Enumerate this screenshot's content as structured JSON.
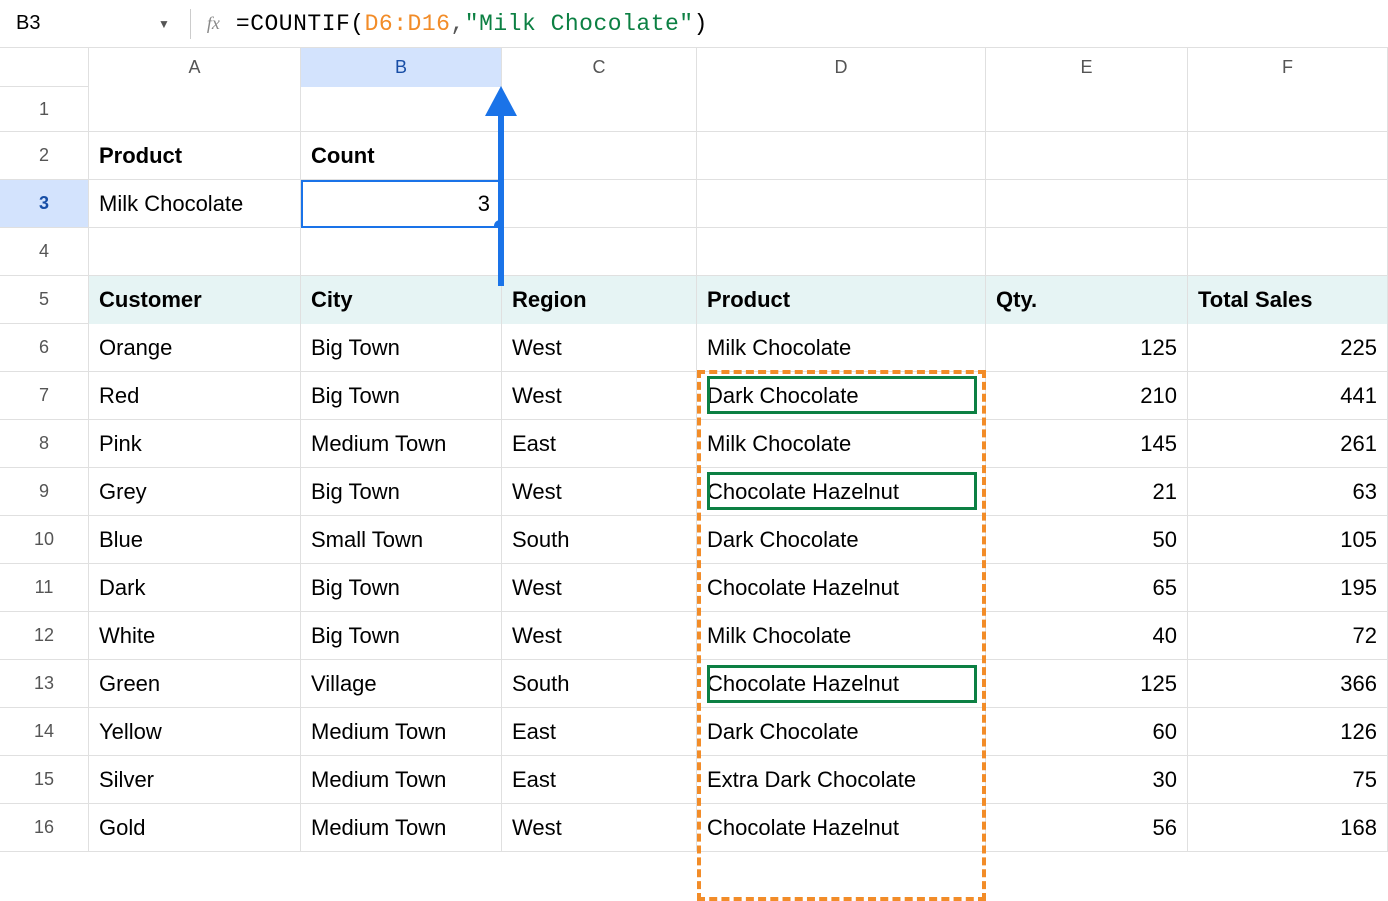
{
  "formula_bar": {
    "cell_ref": "B3",
    "formula_prefix": "=COUNTIF(",
    "formula_range": "D6:D16",
    "formula_comma": ",",
    "formula_string": "\"Milk Chocolate\"",
    "formula_suffix": ")"
  },
  "columns": [
    "A",
    "B",
    "C",
    "D",
    "E",
    "F"
  ],
  "rows": [
    "1",
    "2",
    "3",
    "4",
    "5",
    "6",
    "7",
    "8",
    "9",
    "10",
    "11",
    "12",
    "13",
    "14",
    "15",
    "16"
  ],
  "labels": {
    "product": "Product",
    "count": "Count",
    "a3": "Milk Chocolate",
    "b3": "3"
  },
  "table_headers": {
    "customer": "Customer",
    "city": "City",
    "region": "Region",
    "product": "Product",
    "qty": "Qty.",
    "total": "Total Sales"
  },
  "table": [
    {
      "customer": "Orange",
      "city": "Big Town",
      "region": "West",
      "product": "Milk Chocolate",
      "qty": "125",
      "total": "225"
    },
    {
      "customer": "Red",
      "city": "Big Town",
      "region": "West",
      "product": "Dark Chocolate",
      "qty": "210",
      "total": "441"
    },
    {
      "customer": "Pink",
      "city": "Medium Town",
      "region": "East",
      "product": "Milk Chocolate",
      "qty": "145",
      "total": "261"
    },
    {
      "customer": "Grey",
      "city": "Big Town",
      "region": "West",
      "product": "Chocolate Hazelnut",
      "qty": "21",
      "total": "63"
    },
    {
      "customer": "Blue",
      "city": "Small Town",
      "region": "South",
      "product": "Dark Chocolate",
      "qty": "50",
      "total": "105"
    },
    {
      "customer": "Dark",
      "city": "Big Town",
      "region": "West",
      "product": "Chocolate Hazelnut",
      "qty": "65",
      "total": "195"
    },
    {
      "customer": "White",
      "city": "Big Town",
      "region": "West",
      "product": "Milk Chocolate",
      "qty": "40",
      "total": "72"
    },
    {
      "customer": "Green",
      "city": "Village",
      "region": "South",
      "product": "Chocolate Hazelnut",
      "qty": "125",
      "total": "366"
    },
    {
      "customer": "Yellow",
      "city": "Medium Town",
      "region": "East",
      "product": "Dark Chocolate",
      "qty": "60",
      "total": "126"
    },
    {
      "customer": "Silver",
      "city": "Medium Town",
      "region": "East",
      "product": "Extra Dark Chocolate",
      "qty": "30",
      "total": "75"
    },
    {
      "customer": "Gold",
      "city": "Medium Town",
      "region": "West",
      "product": "Chocolate Hazelnut",
      "qty": "56",
      "total": "168"
    }
  ]
}
